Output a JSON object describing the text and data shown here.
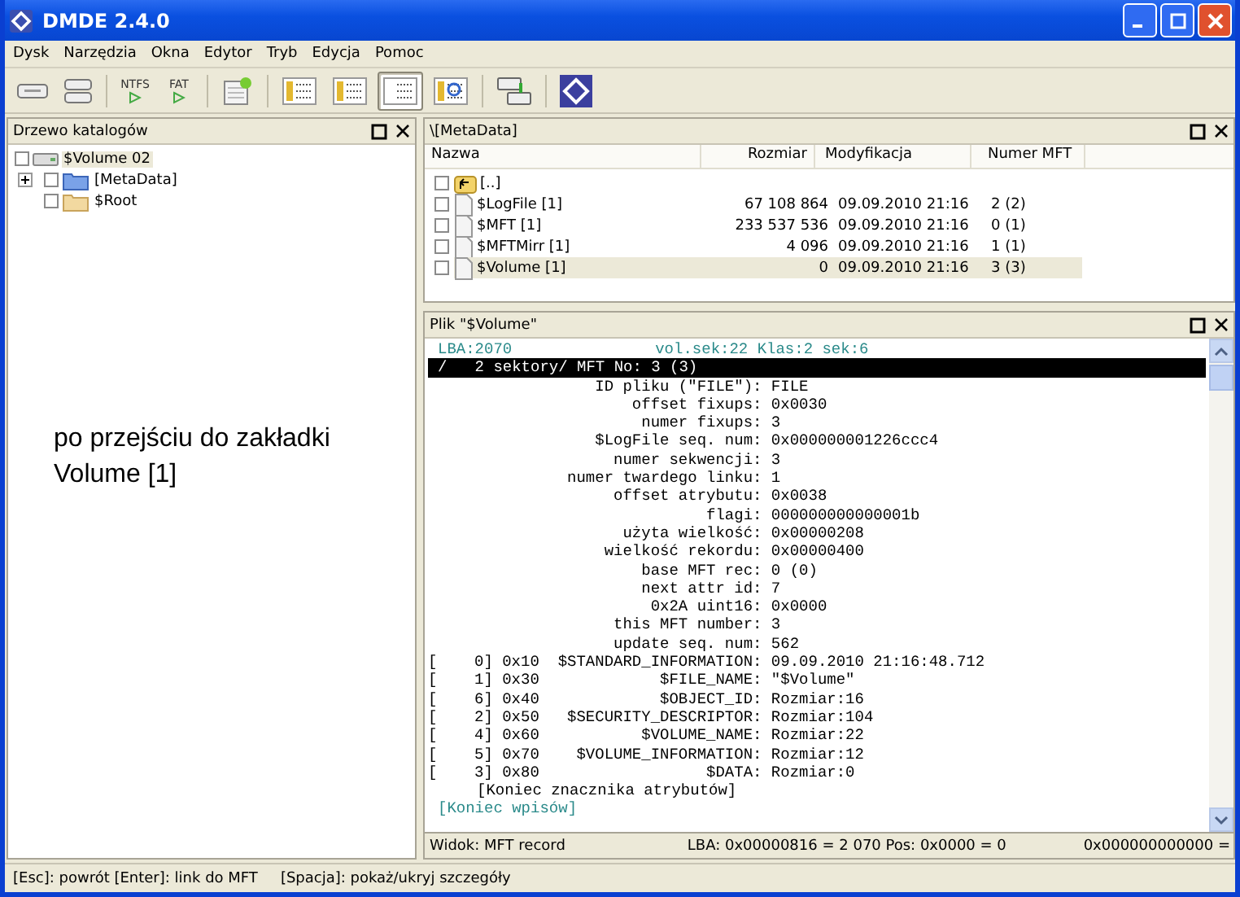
{
  "window": {
    "title": "DMDE 2.4.0"
  },
  "menu": [
    "Dysk",
    "Narzędzia",
    "Okna",
    "Edytor",
    "Tryb",
    "Edycja",
    "Pomoc"
  ],
  "toolbar": [
    [
      {
        "kind": "disk",
        "pressed": false
      },
      {
        "kind": "disks",
        "pressed": false
      }
    ],
    [
      {
        "kind": "fs",
        "label": "NTFS",
        "pressed": false
      },
      {
        "kind": "fs",
        "label": "FAT",
        "pressed": false
      }
    ],
    [
      {
        "kind": "sheet",
        "pressed": false
      }
    ],
    [
      {
        "kind": "tree",
        "pressed": false
      },
      {
        "kind": "list",
        "pressed": false
      },
      {
        "kind": "grid",
        "pressed": true
      },
      {
        "kind": "find",
        "pressed": false
      }
    ],
    [
      {
        "kind": "copy",
        "pressed": false
      }
    ],
    [
      {
        "kind": "logo",
        "pressed": false
      }
    ]
  ],
  "tree_panel": {
    "title": "Drzewo katalogów",
    "items": [
      {
        "kind": "drive",
        "label": "$Volume 02",
        "checked": false,
        "selected": true,
        "children": [
          {
            "kind": "system_folder",
            "label": "[MetaData]",
            "checked": false,
            "expanded": false,
            "selected": false
          },
          {
            "kind": "folder",
            "label": "$Root",
            "checked": false,
            "selected": false
          }
        ]
      }
    ]
  },
  "annotation": "po przejściu do zakładki Volume [1]",
  "files_panel": {
    "title": "\\[MetaData]",
    "columns": [
      "Nazwa",
      "Rozmiar",
      "Modyfikacja",
      "Numer MFT"
    ],
    "rows": [
      {
        "kind": "up",
        "name": "[..]",
        "checked": false,
        "selected": false
      },
      {
        "kind": "file",
        "name": "$LogFile [1]",
        "size": "67 108 864",
        "modified": "09.09.2010 21:16",
        "mft": "2 (2)",
        "checked": false,
        "selected": false
      },
      {
        "kind": "file",
        "name": "$MFT [1]",
        "size": "233 537 536",
        "modified": "09.09.2010 21:16",
        "mft": "0 (1)",
        "checked": false,
        "selected": false
      },
      {
        "kind": "file",
        "name": "$MFTMirr [1]",
        "size": "4 096",
        "modified": "09.09.2010 21:16",
        "mft": "1 (1)",
        "checked": false,
        "selected": false
      },
      {
        "kind": "file",
        "name": "$Volume [1]",
        "size": "0",
        "modified": "09.09.2010 21:16",
        "mft": "3 (3)",
        "checked": false,
        "selected": true
      }
    ]
  },
  "record_panel": {
    "title": "Plik \"$Volume\"",
    "lines": [
      {
        "kind": "header",
        "text": "LBA:2070",
        "text2": "vol.sek:22 Klas:2 sek:6"
      },
      {
        "kind": "title",
        "text": "/   2 sektory/ MFT No: 3 (3)"
      },
      {
        "kind": "field",
        "label": "ID pliku (\"FILE\"):",
        "value": "FILE"
      },
      {
        "kind": "field",
        "label": "offset fixups:",
        "value": "0x0030"
      },
      {
        "kind": "field",
        "label": "numer fixups:",
        "value": "3"
      },
      {
        "kind": "field",
        "label": "$LogFile seq. num:",
        "value": "0x000000001226ccc4"
      },
      {
        "kind": "field",
        "label": "numer sekwencji:",
        "value": "3"
      },
      {
        "kind": "field",
        "label": "numer twardego linku:",
        "value": "1"
      },
      {
        "kind": "field",
        "label": "offset atrybutu:",
        "value": "0x0038"
      },
      {
        "kind": "field",
        "label": "flagi:",
        "value": "000000000000001b"
      },
      {
        "kind": "field",
        "label": "użyta wielkość:",
        "value": "0x00000208"
      },
      {
        "kind": "field",
        "label": "wielkość rekordu:",
        "value": "0x00000400"
      },
      {
        "kind": "field",
        "label": "base MFT rec:",
        "value": "0 (0)"
      },
      {
        "kind": "field",
        "label": "next attr id:",
        "value": "7"
      },
      {
        "kind": "field",
        "label": "0x2A uint16:",
        "value": "0x0000"
      },
      {
        "kind": "field",
        "label": "this MFT number:",
        "value": "3"
      },
      {
        "kind": "field",
        "label": "update seq. num:",
        "value": "562"
      },
      {
        "kind": "field",
        "prefix": "[    0] 0x10",
        "label": "$STANDARD_INFORMATION:",
        "value": "09.09.2010 21:16:48.712"
      },
      {
        "kind": "field",
        "prefix": "[    1] 0x30",
        "label": "$FILE_NAME:",
        "value": "\"$Volume\""
      },
      {
        "kind": "field",
        "prefix": "[    6] 0x40",
        "label": "$OBJECT_ID:",
        "value": "Rozmiar:16"
      },
      {
        "kind": "field",
        "prefix": "[    2] 0x50",
        "label": "$SECURITY_DESCRIPTOR:",
        "value": "Rozmiar:104"
      },
      {
        "kind": "field",
        "prefix": "[    4] 0x60",
        "label": "$VOLUME_NAME:",
        "value": "Rozmiar:22"
      },
      {
        "kind": "field",
        "prefix": "[    5] 0x70",
        "label": "$VOLUME_INFORMATION:",
        "value": "Rozmiar:12"
      },
      {
        "kind": "field",
        "prefix": "[    3] 0x80",
        "label": "$DATA:",
        "value": "Rozmiar:0"
      },
      {
        "kind": "end",
        "text": "[Koniec znacznika atrybutów]"
      },
      {
        "kind": "end2",
        "text": "[Koniec wpisów]"
      }
    ],
    "status": [
      "Widok: MFT record",
      "LBA: 0x00000816 = 2 070  Pos: 0x0000 = 0",
      "0x000000000000 ="
    ]
  },
  "status_bar": [
    "[Esc]: powrót  [Enter]: link do MFT",
    "[Spacja]: pokaż/ukryj szczegóły"
  ]
}
